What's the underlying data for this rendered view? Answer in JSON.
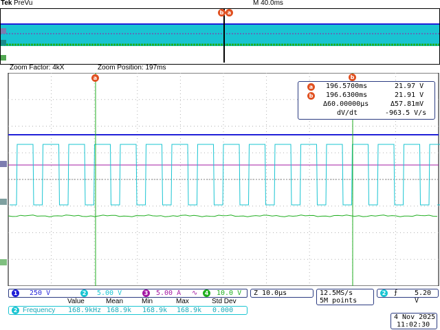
{
  "brand": "Tek",
  "acq_state": "PreVu",
  "timebase_main": "M 40.0ms",
  "zoom": {
    "factor_label": "Zoom Factor: 4kX",
    "position_label": "Zoom Position: 197ms"
  },
  "cursor_markers": {
    "a": "a",
    "b": "b"
  },
  "cursors": {
    "a_time": "196.5700ms",
    "a_value": "21.97 V",
    "b_time": "196.6300ms",
    "b_value": "21.91 V",
    "delta_time": "Δ60.00000µs",
    "delta_value": "Δ57.81mV",
    "dvdt_label": "dV/dt",
    "dvdt_value": "-963.5 V/s"
  },
  "channels": [
    {
      "num": "1",
      "scale": "250 V",
      "color": "#1f1fd8"
    },
    {
      "num": "2",
      "scale": "5.00 V",
      "color": "#19c4d2"
    },
    {
      "num": "3",
      "scale": "5.00 A",
      "suffix": "∿",
      "color": "#a319a3"
    },
    {
      "num": "4",
      "scale": "10.0 V",
      "color": "#1fae1f"
    }
  ],
  "zoom_timebase": "Z 10.0µs",
  "sample_rate": "12.5MS/s",
  "record_length": "5M points",
  "trigger": {
    "channel": "2",
    "slope": "⨍",
    "level": "5.20 V"
  },
  "measurement": {
    "headers": [
      "Value",
      "Mean",
      "Min",
      "Max",
      "Std Dev"
    ],
    "label": "Frequency",
    "channel": "2",
    "values": [
      "168.9kHz",
      "168.9k",
      "168.9k",
      "168.9k",
      "0.000"
    ]
  },
  "date": "4 Nov 2025",
  "time": "11:02:30",
  "colors": {
    "ch1": "#1f1fd8",
    "ch2": "#19c4d2",
    "ch3": "#a319a3",
    "ch4": "#1fae1f",
    "cursor_marker": "#e05020",
    "grid": "#b0b0b0"
  }
}
